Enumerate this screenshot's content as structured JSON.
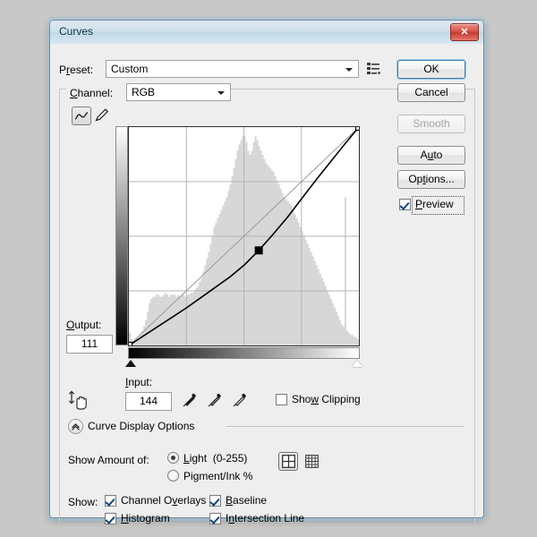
{
  "window": {
    "title": "Curves",
    "close_icon": "close-icon"
  },
  "preset": {
    "label": "Preset:",
    "value": "Custom",
    "menu_icon": "preset-menu-icon"
  },
  "channel": {
    "label": "Channel:",
    "value": "RGB"
  },
  "buttons": {
    "ok": "OK",
    "cancel": "Cancel",
    "smooth": "Smooth",
    "auto": "Auto",
    "options": "Options..."
  },
  "preview": {
    "label": "Preview",
    "checked": true
  },
  "tools": {
    "curve_tool_icon": "curve-tool-icon",
    "pencil_tool_icon": "pencil-tool-icon",
    "curve_tool_selected": true,
    "hand_tool_icon": "on-image-adjust-icon",
    "eyedropper_black_icon": "eyedropper-black-point-icon",
    "eyedropper_gray_icon": "eyedropper-gray-point-icon",
    "eyedropper_white_icon": "eyedropper-white-point-icon"
  },
  "fields": {
    "output_label": "Output:",
    "output_value": "111",
    "input_label": "Input:",
    "input_value": "144"
  },
  "show_clipping": {
    "label": "Show Clipping",
    "checked": false
  },
  "curve_display_options": {
    "label": "Curve Display Options",
    "expanded": true
  },
  "show_amount": {
    "label": "Show Amount of:",
    "options": [
      {
        "label": "Light  (0-255)",
        "selected": true
      },
      {
        "label": "Pigment/Ink %",
        "selected": false
      }
    ],
    "grid_simple_icon": "grid-quarters-icon",
    "grid_detailed_icon": "grid-tenths-icon",
    "grid_simple_selected": true
  },
  "show": {
    "label": "Show:",
    "items": [
      {
        "label": "Channel Overlays",
        "checked": true
      },
      {
        "label": "Baseline",
        "checked": true
      },
      {
        "label": "Histogram",
        "checked": true
      },
      {
        "label": "Intersection Line",
        "checked": true
      }
    ]
  },
  "chart_data": {
    "type": "line",
    "title": "Curves tone curve editor",
    "xlabel": "Input",
    "ylabel": "Output",
    "xlim": [
      0,
      255
    ],
    "ylim": [
      0,
      255
    ],
    "grid": true,
    "grid_divisions": 4,
    "baseline": {
      "from": [
        0,
        0
      ],
      "to": [
        255,
        255
      ]
    },
    "curve_points": [
      {
        "input": 0,
        "output": 0
      },
      {
        "input": 144,
        "output": 111
      },
      {
        "input": 255,
        "output": 255
      }
    ],
    "selected_point": {
      "input": 144,
      "output": 111
    },
    "curve_path": [
      [
        0,
        0
      ],
      [
        16,
        11
      ],
      [
        32,
        22
      ],
      [
        48,
        33
      ],
      [
        64,
        44
      ],
      [
        80,
        56
      ],
      [
        96,
        68
      ],
      [
        112,
        80
      ],
      [
        128,
        94
      ],
      [
        144,
        111
      ],
      [
        160,
        130
      ],
      [
        176,
        150
      ],
      [
        192,
        172
      ],
      [
        208,
        194
      ],
      [
        224,
        215
      ],
      [
        240,
        236
      ],
      [
        255,
        255
      ]
    ],
    "histogram_values": [
      6,
      3,
      2,
      2,
      3,
      4,
      5,
      7,
      9,
      12,
      16,
      20,
      22,
      23,
      23,
      24,
      24,
      23,
      23,
      24,
      25,
      24,
      23,
      24,
      24,
      24,
      23,
      24,
      23,
      24,
      24,
      23,
      24,
      24,
      25,
      25,
      26,
      27,
      28,
      30,
      32,
      35,
      38,
      41,
      44,
      48,
      52,
      56,
      58,
      60,
      62,
      64,
      66,
      68,
      70,
      73,
      76,
      80,
      84,
      88,
      92,
      95,
      97,
      99,
      99,
      96,
      92,
      90,
      92,
      96,
      99,
      97,
      94,
      92,
      90,
      88,
      86,
      85,
      84,
      83,
      82,
      80,
      78,
      76,
      74,
      72,
      70,
      69,
      68,
      67,
      66,
      64,
      62,
      60,
      58,
      56,
      54,
      52,
      50,
      48,
      46,
      44,
      42,
      40,
      38,
      36,
      34,
      32,
      30,
      28,
      26,
      24,
      22,
      20,
      18,
      16,
      14,
      12,
      10,
      9,
      8,
      7,
      6,
      5,
      5,
      4,
      4,
      3
    ],
    "histogram_peak_bin": 63,
    "histogram_spike": {
      "bin": 120,
      "value": 70
    },
    "axis_gradient_horizontal": [
      "#000000",
      "#ffffff"
    ],
    "axis_gradient_vertical": [
      "#ffffff",
      "#000000"
    ],
    "black_point_marker": 0,
    "white_point_marker": 255
  },
  "colors": {
    "accent_blue": "#3c7fb1",
    "titlebar": "#cfe0ec",
    "dialog_bg": "#eeeeee",
    "desktop_bg": "#c8c8c8",
    "close_red": "#c53a30",
    "histogram_gray": "#d7d7d7"
  }
}
